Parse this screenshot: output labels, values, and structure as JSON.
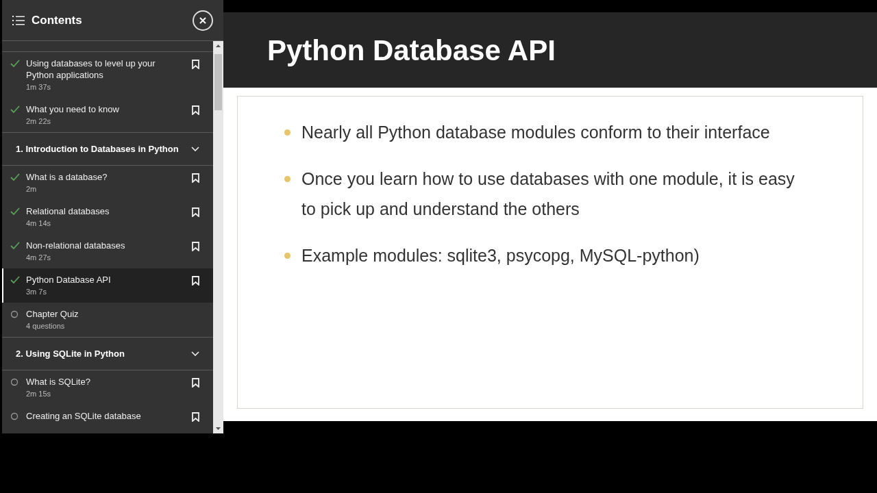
{
  "sidebar": {
    "title": "Contents",
    "items": [
      {
        "kind": "lesson",
        "title": "Using databases to level up your Python applications",
        "meta": "1m 37s",
        "completed": true,
        "selected": false,
        "bookmark": true
      },
      {
        "kind": "lesson",
        "title": "What you need to know",
        "meta": "2m 22s",
        "completed": true,
        "selected": false,
        "bookmark": true
      },
      {
        "kind": "chapter",
        "title": "1. Introduction to Databases in Python",
        "expanded": true
      },
      {
        "kind": "lesson",
        "title": "What is a database?",
        "meta": "2m",
        "completed": true,
        "selected": false,
        "bookmark": true
      },
      {
        "kind": "lesson",
        "title": "Relational databases",
        "meta": "4m 14s",
        "completed": true,
        "selected": false,
        "bookmark": true
      },
      {
        "kind": "lesson",
        "title": "Non-relational databases",
        "meta": "4m 27s",
        "completed": true,
        "selected": false,
        "bookmark": true
      },
      {
        "kind": "lesson",
        "title": "Python Database API",
        "meta": "3m 7s",
        "completed": true,
        "selected": true,
        "bookmark": true
      },
      {
        "kind": "lesson",
        "title": "Chapter Quiz",
        "meta": "4 questions",
        "completed": false,
        "selected": false,
        "bookmark": false
      },
      {
        "kind": "chapter",
        "title": "2. Using SQLite in Python",
        "expanded": true
      },
      {
        "kind": "lesson",
        "title": "What is SQLite?",
        "meta": "2m 15s",
        "completed": false,
        "selected": false,
        "bookmark": true
      },
      {
        "kind": "lesson",
        "title": "Creating an SQLite database",
        "completed": false,
        "selected": false,
        "bookmark": true
      }
    ]
  },
  "slide": {
    "title": "Python Database API",
    "bullets": [
      "Nearly all Python database modules conform to their interface",
      "Once you learn how to use databases with one module, it is easy to pick up and understand the others",
      "Example modules: sqlite3, psycopg, MySQL-python)"
    ]
  }
}
